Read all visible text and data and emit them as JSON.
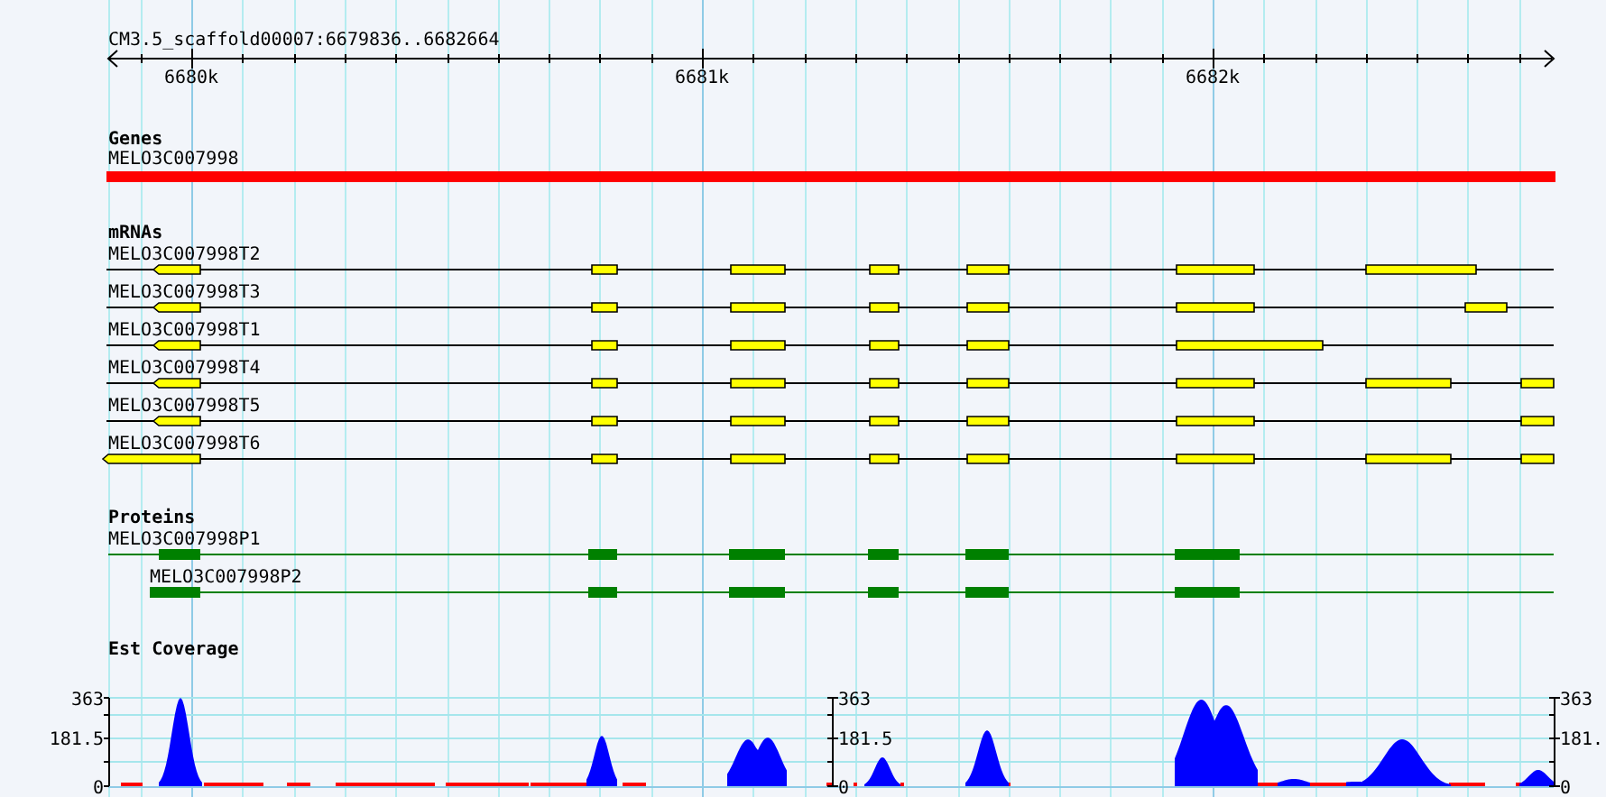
{
  "ruler": {
    "title": "CM3.5_scaffold00007:6679836..6682664",
    "tick_labels": [
      "6680k",
      "6681k",
      "6682k"
    ]
  },
  "tracks": [
    {
      "kind": "genes",
      "title": "Genes",
      "features": [
        {
          "label": "MELO3C007998"
        }
      ]
    },
    {
      "kind": "mrnas",
      "title": "mRNAs",
      "features": [
        {
          "label": "MELO3C007998T2"
        },
        {
          "label": "MELO3C007998T3"
        },
        {
          "label": "MELO3C007998T1"
        },
        {
          "label": "MELO3C007998T4"
        },
        {
          "label": "MELO3C007998T5"
        },
        {
          "label": "MELO3C007998T6"
        }
      ]
    },
    {
      "kind": "proteins",
      "title": "Proteins",
      "features": [
        {
          "label": "MELO3C007998P1"
        },
        {
          "label": "MELO3C007998P2"
        }
      ]
    },
    {
      "kind": "coverage",
      "title": "Est Coverage",
      "axes": [
        {
          "labels": [
            "363",
            "181.5",
            "0"
          ]
        },
        {
          "labels": [
            "363",
            "181.5",
            "0"
          ]
        },
        {
          "labels": [
            "363",
            "181.",
            "0"
          ]
        }
      ]
    }
  ]
}
